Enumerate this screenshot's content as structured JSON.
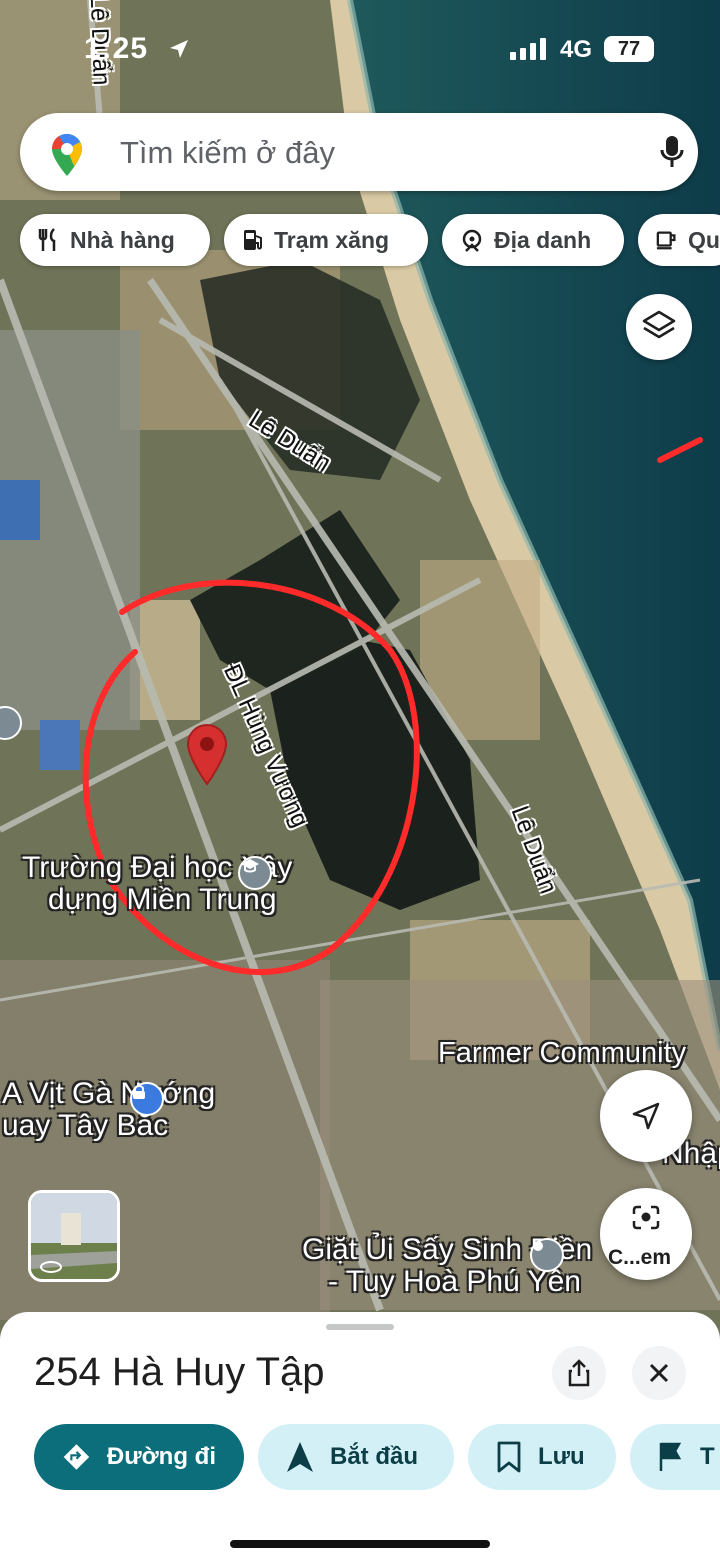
{
  "status_bar": {
    "time": "1:25",
    "network": "4G",
    "battery": "77"
  },
  "search": {
    "placeholder": "Tìm kiếm ở đây"
  },
  "chips": [
    {
      "label": "Nhà hàng",
      "icon": "restaurant-icon"
    },
    {
      "label": "Trạm xăng",
      "icon": "gas-station-icon"
    },
    {
      "label": "Địa danh",
      "icon": "landmark-icon"
    },
    {
      "label": "Qu",
      "icon": "cafe-icon"
    }
  ],
  "map": {
    "roads": {
      "le_duan_1": "Lê Duẩn",
      "le_duan_2": "Lê Duẩn",
      "le_duan_3": "Lê Duẩn",
      "hung_vuong": "ĐL Hùng Vương"
    },
    "places": {
      "university_line1": "Trường Đại học Xây",
      "university_line2": "dựng Miền Trung",
      "farmer": "Farmer Community",
      "restaurant_line1": "A Vịt Gà Nướng",
      "restaurant_line2": "uay Tây Bắc",
      "laundry_line1": "Giặt Ủi Sấy Sinh Điền",
      "laundry_line2": "- Tuy Hoà Phú Yên",
      "cut_right": "Nhập N"
    },
    "lens_label": "C...em"
  },
  "bottom_sheet": {
    "address": "254 Hà Huy Tập",
    "buttons": {
      "directions": "Đường đi",
      "start": "Bắt đầu",
      "save": "Lưu",
      "more": "T"
    }
  },
  "colors": {
    "accent": "#0b6e7a",
    "light_accent": "#d3f0f7",
    "pin": "#d62f2f",
    "annotation": "#ff2a2a"
  }
}
